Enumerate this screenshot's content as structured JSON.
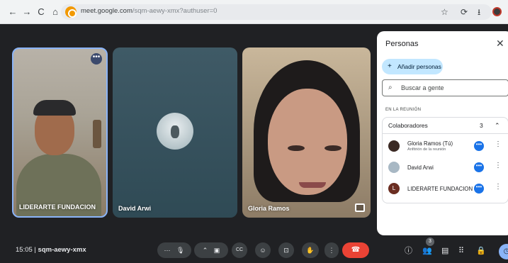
{
  "browser": {
    "url_domain": "meet.google.com",
    "url_path": "/sqm-aewy-xmx?authuser=0",
    "nav": [
      "←",
      "→",
      "C",
      "⌂"
    ],
    "right_icons": [
      "☆",
      "⟳",
      "⭳"
    ]
  },
  "tiles": [
    {
      "name": "LIDERARTE FUNDACION",
      "more": "•••"
    },
    {
      "name": "David Arwi"
    },
    {
      "name": "Gloria Ramos"
    }
  ],
  "panel": {
    "title": "Personas",
    "close": "✕",
    "add_label": "Añadir personas",
    "add_icon": "+",
    "search_placeholder": "Buscar a gente",
    "search_icon": "⌕",
    "section_label": "EN LA REUNIÓN",
    "group_label": "Colaboradores",
    "group_count": "3",
    "group_chevron": "⌃",
    "people": [
      {
        "name": "Gloria Ramos (Tú)",
        "sub": "Anfitrión de la reunión",
        "avatar_color": "#3b2a24"
      },
      {
        "name": "David Arwi",
        "sub": "",
        "avatar_color": "#a8b8c4"
      },
      {
        "name": "LIDERARTE FUNDACION",
        "sub": "",
        "avatar_color": "#6b2e22",
        "avatar_letter": "L"
      }
    ],
    "more_glyph": "•••",
    "kebab_glyph": "⋮"
  },
  "controls": {
    "time": "15:05",
    "separator": "|",
    "meeting_code": "sqm-aewy-xmx",
    "mic_more": "⋯",
    "mic": "🎙",
    "cam_more": "⌃",
    "cam": "▣",
    "captions": "CC",
    "emoji": "☺",
    "present": "⊡",
    "hand": "✋",
    "more": "⋮",
    "end": "☎",
    "info": "ⓘ",
    "people": "👥",
    "people_badge": "3",
    "chat": "▤",
    "activities": "⠿",
    "lock": "🔒",
    "clock": "◷"
  }
}
